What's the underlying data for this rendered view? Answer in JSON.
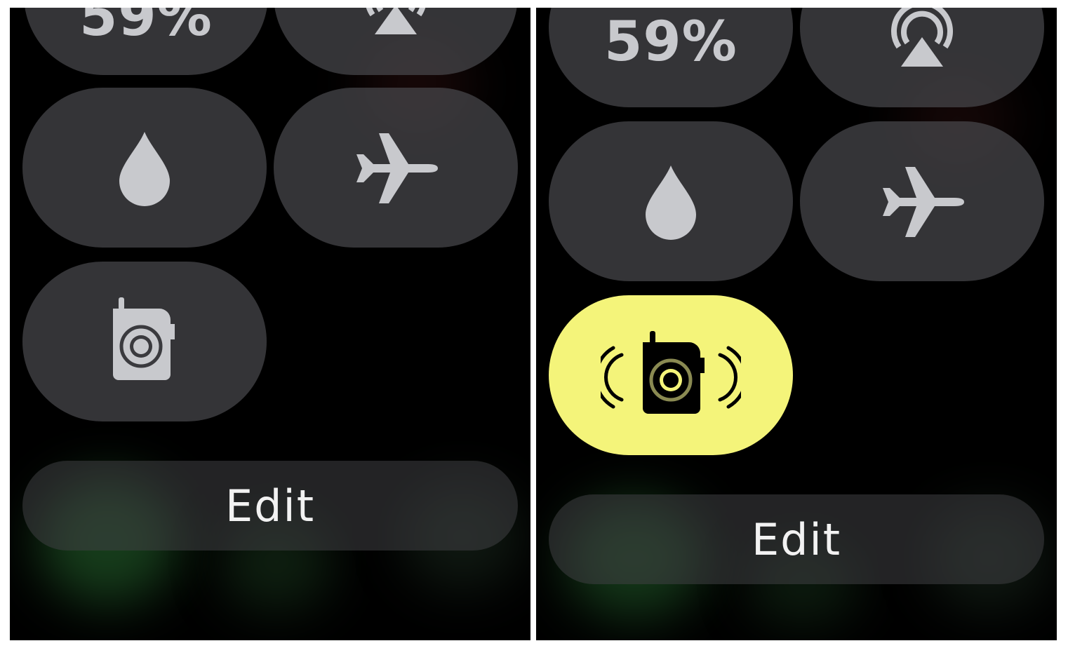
{
  "before": {
    "battery_tile": {
      "label": "59%",
      "icon": "battery-percentage"
    },
    "airplay_tile": {
      "icon": "airplay-icon"
    },
    "water_lock_tile": {
      "icon": "water-drop-icon"
    },
    "airplane_mode_tile": {
      "icon": "airplane-icon"
    },
    "walkie_talkie_tile": {
      "icon": "walkie-talkie-icon",
      "state": "off"
    },
    "edit_button": {
      "label": "Edit"
    }
  },
  "after": {
    "battery_tile": {
      "label": "59%",
      "icon": "battery-percentage"
    },
    "airplay_tile": {
      "icon": "airplay-icon"
    },
    "water_lock_tile": {
      "icon": "water-drop-icon"
    },
    "airplane_mode_tile": {
      "icon": "airplane-icon"
    },
    "walkie_talkie_tile": {
      "icon": "walkie-talkie-icon",
      "state": "on"
    },
    "edit_button": {
      "label": "Edit"
    }
  },
  "colors": {
    "background": "#000000",
    "tile": "#48484c",
    "icon": "#c8c9cd",
    "walkie_talkie_active": "#f4f47a",
    "edit_text": "#f2f2f2"
  }
}
